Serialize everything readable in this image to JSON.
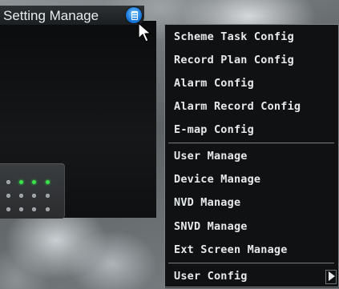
{
  "window": {
    "title": "Setting Manage"
  },
  "menu": {
    "group1": [
      {
        "label": "Scheme Task Config"
      },
      {
        "label": "Record Plan Config"
      },
      {
        "label": "Alarm Config"
      },
      {
        "label": "Alarm Record Config"
      },
      {
        "label": "E-map Config"
      }
    ],
    "group2": [
      {
        "label": "User Manage"
      },
      {
        "label": "Device Manage"
      },
      {
        "label": "NVD Manage"
      },
      {
        "label": "SNVD Manage"
      },
      {
        "label": "Ext Screen Manage"
      }
    ],
    "group3": [
      {
        "label": "User Config",
        "has_submenu": true
      }
    ]
  },
  "colors": {
    "menu_bg": "#0f1112",
    "menu_text": "#e6eaed",
    "icon_blue": "#1e7fe0",
    "led_green": "#38e44a"
  },
  "icons": {
    "menu_button": "menu-list-icon",
    "cursor": "arrow-cursor-icon",
    "submenu": "submenu-arrow-icon"
  }
}
